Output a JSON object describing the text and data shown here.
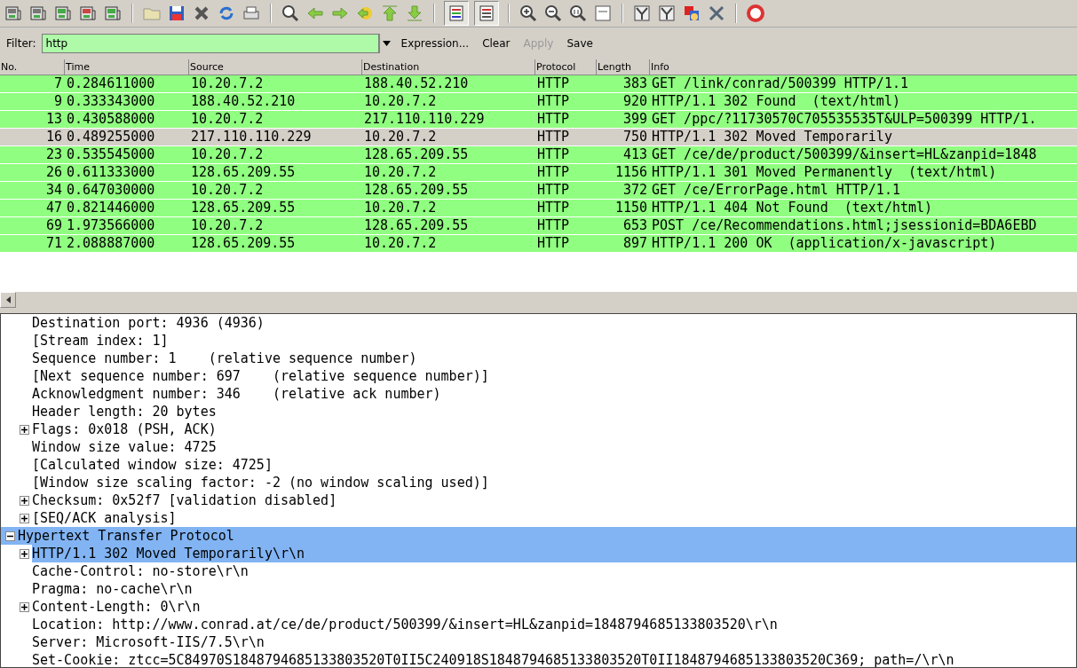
{
  "toolbar": {
    "colorize": {
      "on": true
    },
    "auto_scroll": {
      "on": true
    }
  },
  "filter": {
    "label": "Filter:",
    "value": "http",
    "buttons": [
      {
        "label": "Expression...",
        "disabled": false
      },
      {
        "label": "Clear",
        "disabled": false
      },
      {
        "label": "Apply",
        "disabled": true
      },
      {
        "label": "Save",
        "disabled": false
      }
    ]
  },
  "packet_list": {
    "columns": [
      "No.",
      "Time",
      "Source",
      "Destination",
      "Protocol",
      "Length",
      "Info"
    ],
    "rows": [
      {
        "no": "7",
        "time": "0.284611000",
        "source": "10.20.7.2",
        "destination": "188.40.52.210",
        "protocol": "HTTP",
        "length": "383",
        "info": "GET /link/conrad/500399 HTTP/1.1",
        "selected": false
      },
      {
        "no": "9",
        "time": "0.333343000",
        "source": "188.40.52.210",
        "destination": "10.20.7.2",
        "protocol": "HTTP",
        "length": "920",
        "info": "HTTP/1.1 302 Found  (text/html)",
        "selected": false
      },
      {
        "no": "13",
        "time": "0.430588000",
        "source": "10.20.7.2",
        "destination": "217.110.110.229",
        "protocol": "HTTP",
        "length": "399",
        "info": "GET /ppc/?11730570C705535535T&ULP=500399 HTTP/1.",
        "selected": false
      },
      {
        "no": "16",
        "time": "0.489255000",
        "source": "217.110.110.229",
        "destination": "10.20.7.2",
        "protocol": "HTTP",
        "length": "750",
        "info": "HTTP/1.1 302 Moved Temporarily",
        "selected": true
      },
      {
        "no": "23",
        "time": "0.535545000",
        "source": "10.20.7.2",
        "destination": "128.65.209.55",
        "protocol": "HTTP",
        "length": "413",
        "info": "GET /ce/de/product/500399/&insert=HL&zanpid=1848",
        "selected": false
      },
      {
        "no": "26",
        "time": "0.611333000",
        "source": "128.65.209.55",
        "destination": "10.20.7.2",
        "protocol": "HTTP",
        "length": "1156",
        "info": "HTTP/1.1 301 Moved Permanently  (text/html)",
        "selected": false
      },
      {
        "no": "34",
        "time": "0.647030000",
        "source": "10.20.7.2",
        "destination": "128.65.209.55",
        "protocol": "HTTP",
        "length": "372",
        "info": "GET /ce/ErrorPage.html HTTP/1.1",
        "selected": false
      },
      {
        "no": "47",
        "time": "0.821446000",
        "source": "128.65.209.55",
        "destination": "10.20.7.2",
        "protocol": "HTTP",
        "length": "1150",
        "info": "HTTP/1.1 404 Not Found  (text/html)",
        "selected": false
      },
      {
        "no": "69",
        "time": "1.973566000",
        "source": "10.20.7.2",
        "destination": "128.65.209.55",
        "protocol": "HTTP",
        "length": "653",
        "info": "POST /ce/Recommendations.html;jsessionid=BDA6EBD",
        "selected": false
      },
      {
        "no": "71",
        "time": "2.088887000",
        "source": "128.65.209.55",
        "destination": "10.20.7.2",
        "protocol": "HTTP",
        "length": "897",
        "info": "HTTP/1.1 200 OK  (application/x-javascript)",
        "selected": false
      }
    ]
  },
  "detail_tree": [
    {
      "children": [
        {
          "label": "Destination port: 4936 (4936)",
          "selected": false
        },
        {
          "label": "[Stream index: 1]",
          "selected": false
        },
        {
          "label": "Sequence number: 1    (relative sequence number)",
          "selected": false
        },
        {
          "label": "[Next sequence number: 697    (relative sequence number)]",
          "selected": false
        },
        {
          "label": "Acknowledgment number: 346    (relative ack number)",
          "selected": false
        },
        {
          "label": "Header length: 20 bytes",
          "selected": false
        },
        {
          "label": "Flags: 0x018 (PSH, ACK)",
          "expanded": false,
          "selected": false
        },
        {
          "label": "Window size value: 4725",
          "selected": false
        },
        {
          "label": "[Calculated window size: 4725]",
          "selected": false
        },
        {
          "label": "[Window size scaling factor: -2 (no window scaling used)]",
          "selected": false
        },
        {
          "label": "Checksum: 0x52f7 [validation disabled]",
          "expanded": false,
          "selected": false
        },
        {
          "label": "[SEQ/ACK analysis]",
          "expanded": false,
          "selected": false
        }
      ]
    },
    {
      "label": "Hypertext Transfer Protocol",
      "expanded": true,
      "selected": true,
      "children": [
        {
          "label": "HTTP/1.1 302 Moved Temporarily\\r\\n",
          "expanded": false,
          "selected": true
        },
        {
          "label": "Cache-Control: no-store\\r\\n",
          "selected": false
        },
        {
          "label": "Pragma: no-cache\\r\\n",
          "selected": false
        },
        {
          "label": "Content-Length: 0\\r\\n",
          "expanded": false,
          "selected": false
        },
        {
          "label": "Location: http://www.conrad.at/ce/de/product/500399/&insert=HL&zanpid=1848794685133803520\\r\\n",
          "selected": false
        },
        {
          "label": "Server: Microsoft-IIS/7.5\\r\\n",
          "selected": false
        },
        {
          "label": "Set-Cookie: ztcc=5C84970S1848794685133803520T0II5C240918S1848794685133803520T0II1848794685133803520C369; path=/\\r\\n",
          "selected": false
        }
      ]
    }
  ]
}
